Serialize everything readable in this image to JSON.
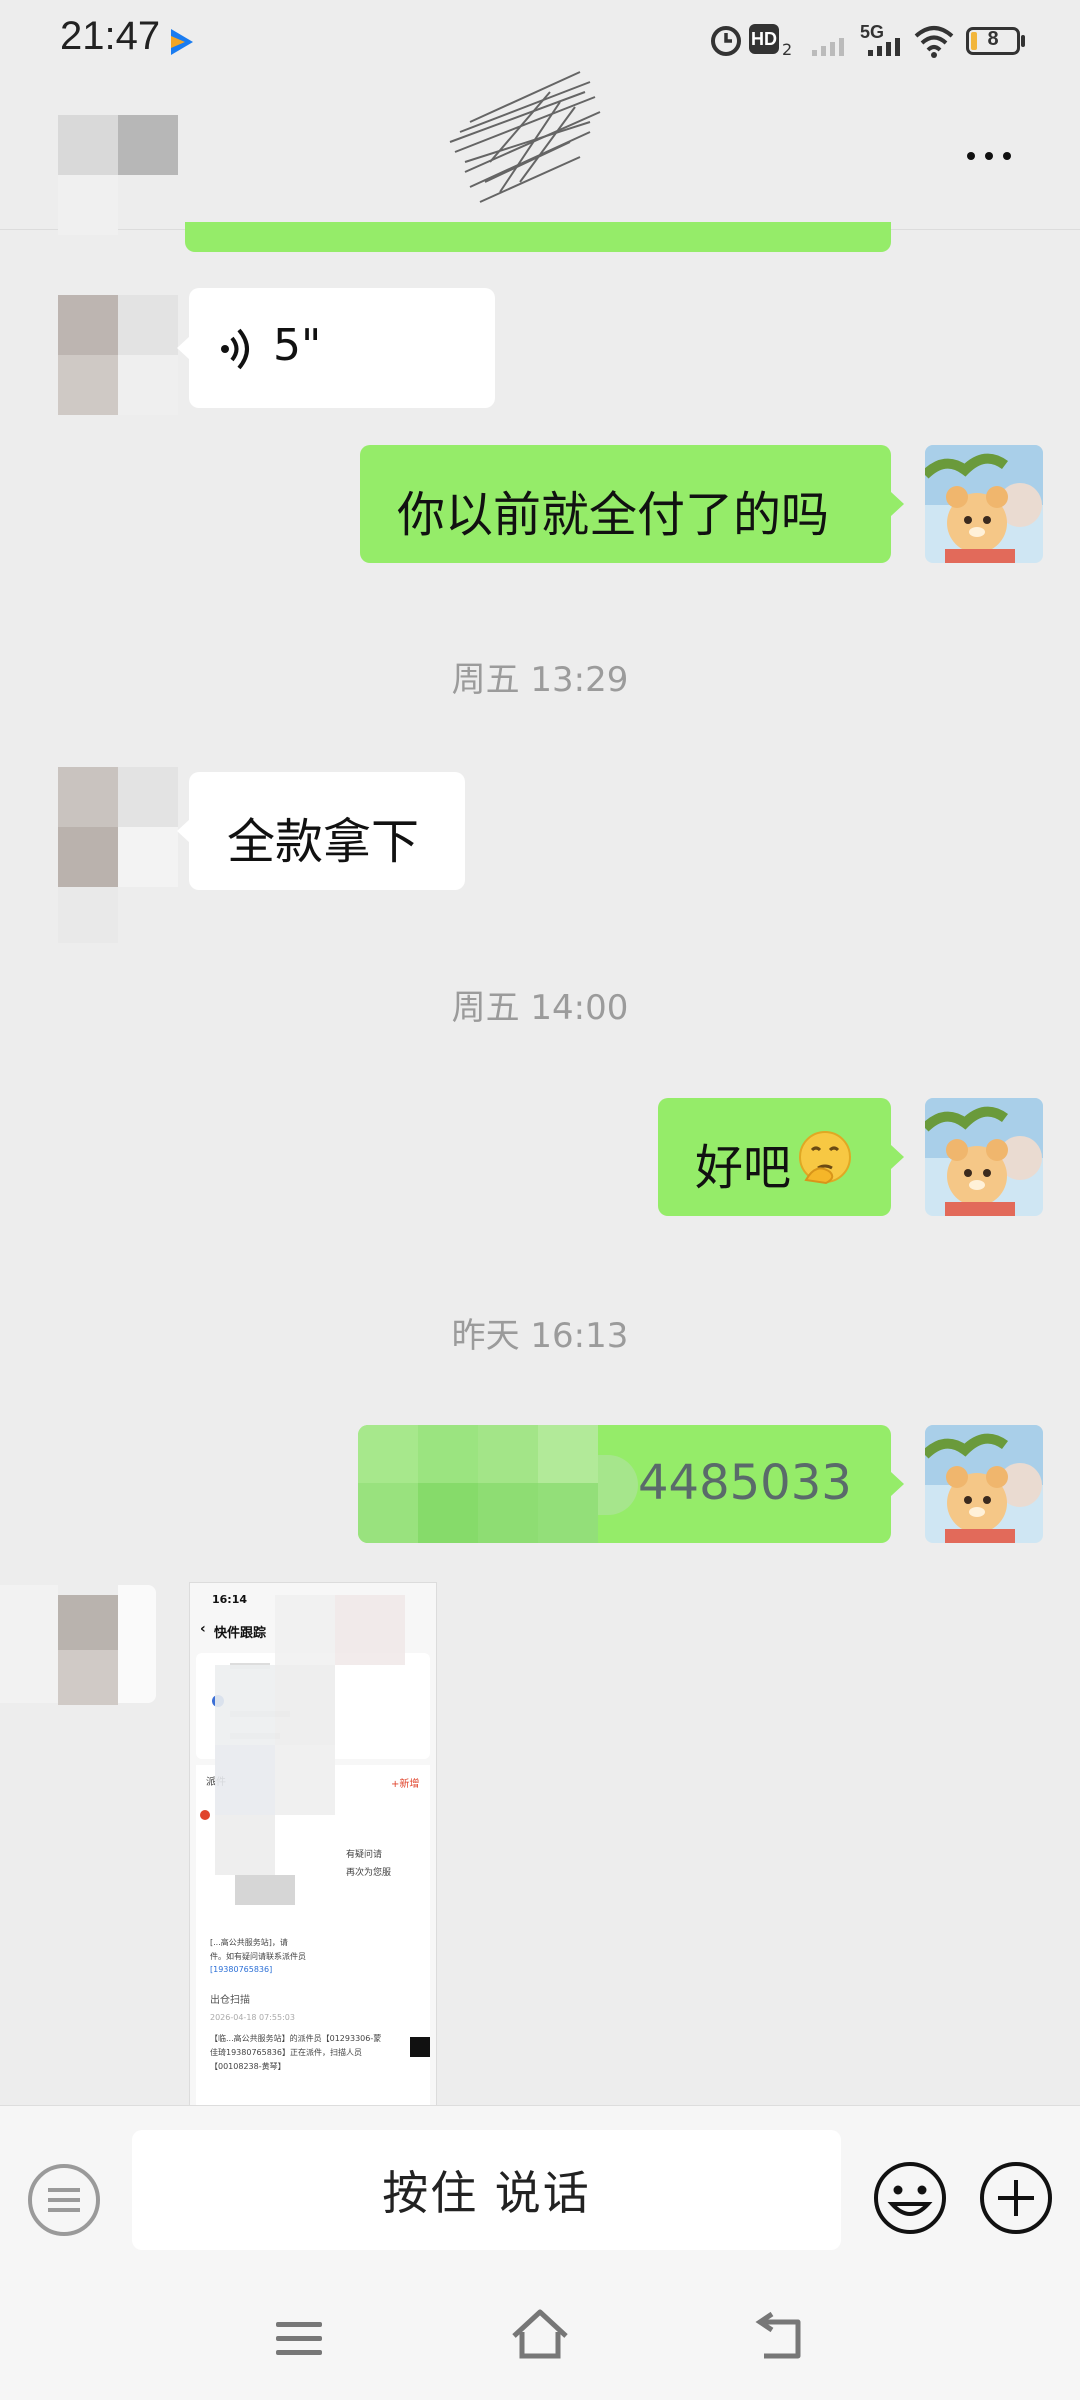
{
  "status": {
    "time": "21:47",
    "battery": "8",
    "network": "5G"
  },
  "messages": {
    "voice": {
      "duration": "5\""
    },
    "m1": "你以前就全付了的吗",
    "t1": "周五 13:29",
    "m2": "全款拿下",
    "t2": "周五 14:00",
    "m3": "好吧",
    "t3": "昨天 16:13",
    "m4": "4485033",
    "screenshot": {
      "time": "16:14",
      "title": "快件跟踪",
      "add": "+新增",
      "section": "派件",
      "note_a": "有疑问请",
      "note_b": "再次为您服",
      "line1": "[...高公共服务站]，请",
      "line2": "件。如有疑问请联系派件员",
      "phone1": "[19380765836]",
      "line3": "出仓扫描",
      "date": "2026-04-18 07:55:03",
      "line4": "【临...高公共服务站】的派件员【01293306-蒙",
      "line5": "佳琦19380765836】正在派件，扫描人员",
      "line6": "【00108238-黄琴】"
    }
  },
  "input": {
    "hold_to_talk": "按住 说话"
  },
  "colors": {
    "bg": "#ededed",
    "green_bubble": "#95ec69",
    "white_bubble": "#ffffff"
  }
}
